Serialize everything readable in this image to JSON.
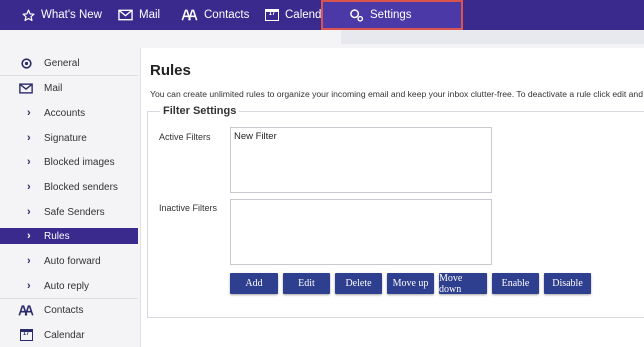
{
  "topnav": {
    "items": [
      {
        "label": "What's New",
        "icon": "star-icon"
      },
      {
        "label": "Mail",
        "icon": "mail-icon"
      },
      {
        "label": "Contacts",
        "icon": "contacts-icon"
      },
      {
        "label": "Calendar",
        "icon": "calendar-icon",
        "icon_text": "17"
      },
      {
        "label": "Settings",
        "icon": "settings-icon",
        "active": true
      }
    ]
  },
  "sidebar": {
    "items": [
      {
        "label": "General",
        "icon": "gear-icon"
      },
      {
        "label": "Mail",
        "icon": "mail-icon"
      },
      {
        "label": "Accounts",
        "icon": "chevron-right-icon"
      },
      {
        "label": "Signature",
        "icon": "chevron-right-icon"
      },
      {
        "label": "Blocked images",
        "icon": "chevron-right-icon"
      },
      {
        "label": "Blocked senders",
        "icon": "chevron-right-icon"
      },
      {
        "label": "Safe Senders",
        "icon": "chevron-right-icon"
      },
      {
        "label": "Rules",
        "icon": "chevron-right-icon",
        "active": true
      },
      {
        "label": "Auto forward",
        "icon": "chevron-right-icon"
      },
      {
        "label": "Auto reply",
        "icon": "chevron-right-icon"
      },
      {
        "label": "Contacts",
        "icon": "contacts-icon"
      },
      {
        "label": "Calendar",
        "icon": "calendar-icon",
        "icon_text": "17"
      }
    ]
  },
  "main": {
    "title": "Rules",
    "description": "You can create unlimited rules to organize your incoming email and keep your inbox clutter-free. To deactivate a rule click edit and",
    "filter_settings": {
      "legend": "Filter Settings",
      "active_label": "Active Filters",
      "active_items": [
        "New Filter"
      ],
      "inactive_label": "Inactive Filters",
      "inactive_items": []
    },
    "buttons": [
      "Add",
      "Edit",
      "Delete",
      "Move up",
      "Move down",
      "Enable",
      "Disable"
    ]
  },
  "colors": {
    "brand": "#3a2a8e",
    "button": "#2e3f8f",
    "highlight_outline": "#d9534f"
  }
}
